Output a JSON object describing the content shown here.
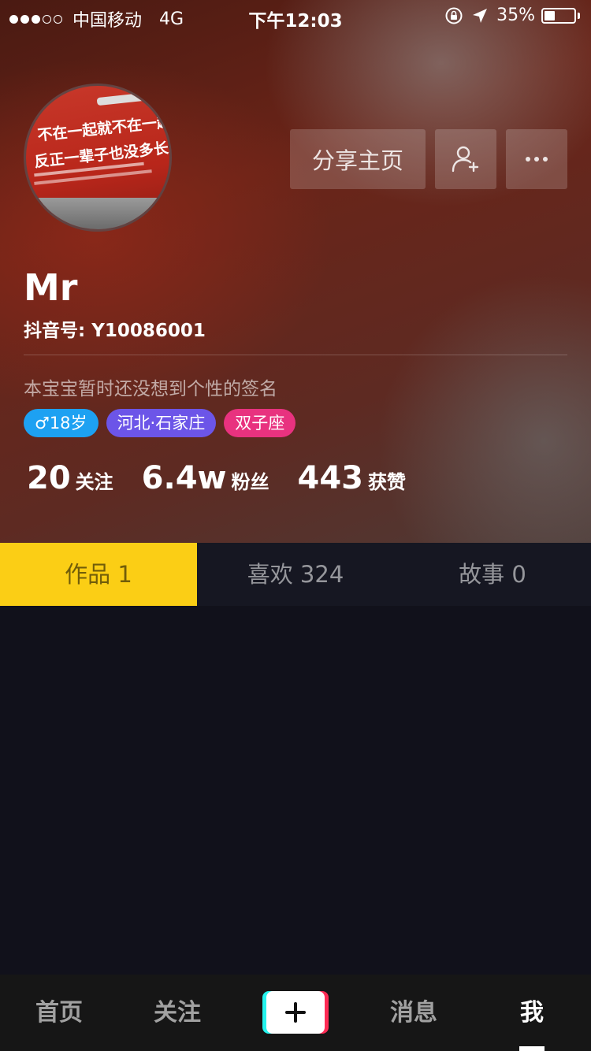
{
  "status_bar": {
    "carrier": "中国移动",
    "network": "4G",
    "time": "下午12:03",
    "battery": "35%",
    "battery_level": 0.35,
    "signal_bars_filled": 3,
    "signal_bars_total": 5
  },
  "profile": {
    "avatar_text_line1": "不在一起就不在一起吧,",
    "avatar_text_line2": "反正一辈子也没多长。",
    "name": "Mr",
    "douyin_id": "抖音号: Y10086001",
    "signature": "本宝宝暂时还没想到个性的签名",
    "tags": [
      {
        "label": "♂18岁",
        "color": "#1da1f2"
      },
      {
        "label": "河北·石家庄",
        "color": "#6c55e8"
      },
      {
        "label": "双子座",
        "color": "#e8327f"
      }
    ]
  },
  "actions": {
    "share_label": "分享主页",
    "add_friend_icon": "add-user-icon",
    "more_icon": "more-icon"
  },
  "stats": {
    "following_count": "20",
    "following_label": "关注",
    "fans_count": "6.4w",
    "fans_label": "粉丝",
    "likes_count": "443",
    "likes_label": "获赞"
  },
  "tabs": [
    {
      "label": "作品 1",
      "active": true
    },
    {
      "label": "喜欢 324",
      "active": false
    },
    {
      "label": "故事 0",
      "active": false
    }
  ],
  "bottom_nav": {
    "home": "首页",
    "follow": "关注",
    "messages": "消息",
    "me": "我",
    "create_icon": "plus-icon"
  }
}
